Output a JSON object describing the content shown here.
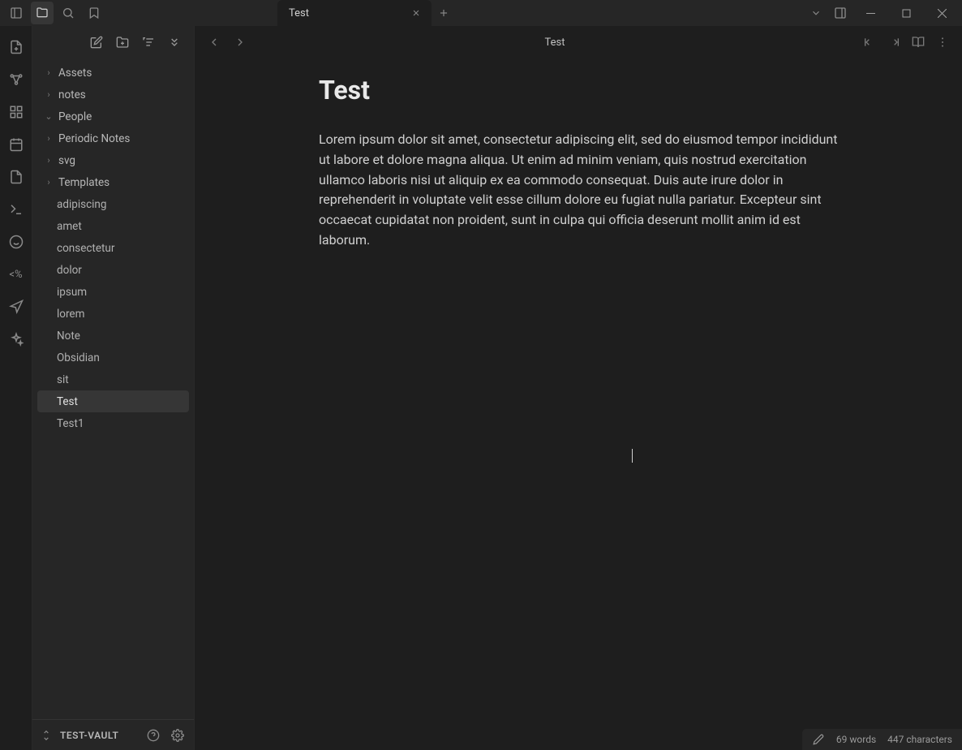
{
  "tab": {
    "title": "Test"
  },
  "editor": {
    "breadcrumb": "Test",
    "title": "Test",
    "body": "Lorem ipsum dolor sit amet, consectetur adipiscing elit, sed do eiusmod tempor incididunt ut labore et dolore magna aliqua. Ut enim ad minim veniam, quis nostrud exercitation ullamco laboris nisi ut aliquip ex ea commodo consequat. Duis aute irure dolor in reprehenderit in voluptate velit esse cillum dolore eu fugiat nulla pariatur. Excepteur sint occaecat cupidatat non proident, sunt in culpa qui officia deserunt mollit anim id est laborum."
  },
  "sidebar": {
    "folders": [
      {
        "name": "Assets",
        "expanded": false
      },
      {
        "name": "notes",
        "expanded": false
      },
      {
        "name": "People",
        "expanded": true
      },
      {
        "name": "Periodic Notes",
        "expanded": false
      },
      {
        "name": "svg",
        "expanded": false
      },
      {
        "name": "Templates",
        "expanded": false
      }
    ],
    "files": [
      {
        "name": "adipiscing",
        "active": false
      },
      {
        "name": "amet",
        "active": false
      },
      {
        "name": "consectetur",
        "active": false
      },
      {
        "name": "dolor",
        "active": false
      },
      {
        "name": "ipsum",
        "active": false
      },
      {
        "name": "lorem",
        "active": false
      },
      {
        "name": "Note",
        "active": false
      },
      {
        "name": "Obsidian",
        "active": false
      },
      {
        "name": "sit",
        "active": false
      },
      {
        "name": "Test",
        "active": true
      },
      {
        "name": "Test1",
        "active": false
      }
    ],
    "vault": "TEST-VAULT"
  },
  "status": {
    "words": "69 words",
    "chars": "447 characters"
  }
}
